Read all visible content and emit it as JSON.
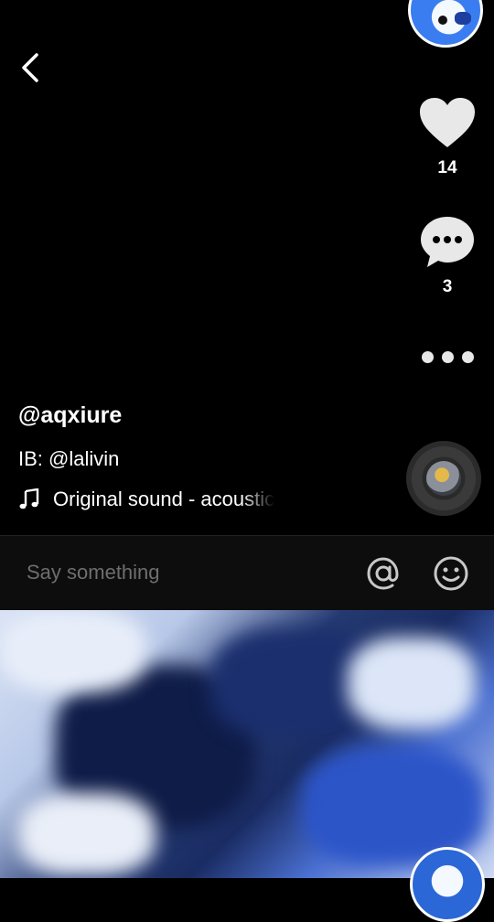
{
  "post": {
    "username": "@aqxiure",
    "caption": "IB: @lalivin",
    "sound": "Original sound - acoustic"
  },
  "actions": {
    "like_count": "14",
    "comment_count": "3"
  },
  "comment_bar": {
    "placeholder": "Say something"
  },
  "icons": {
    "back": "chevron-left-icon",
    "like": "heart-icon",
    "comment": "speech-bubble-icon",
    "more": "more-dots-icon",
    "music": "music-note-icon",
    "mention": "at-sign-icon",
    "emoji": "smiley-icon"
  },
  "colors": {
    "background": "#000000",
    "placeholder": "#6e6e6e",
    "icon": "#e8e8e8"
  }
}
